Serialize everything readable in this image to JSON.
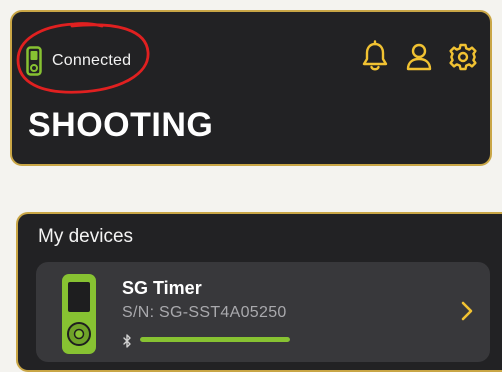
{
  "header": {
    "connection_status": "Connected",
    "page_title": "SHOOTING",
    "icons": [
      "bell-icon",
      "user-icon",
      "gear-icon"
    ]
  },
  "devices": {
    "section_title": "My devices",
    "items": [
      {
        "name": "SG Timer",
        "serial": "S/N: SG-SST4A05250",
        "battery_level": 1.0,
        "icon": "timer-device-icon"
      }
    ]
  },
  "colors": {
    "accent_gold": "#f1c232",
    "brand_green": "#87c232",
    "card_bg": "#222224",
    "annotation_red": "#e02020"
  }
}
